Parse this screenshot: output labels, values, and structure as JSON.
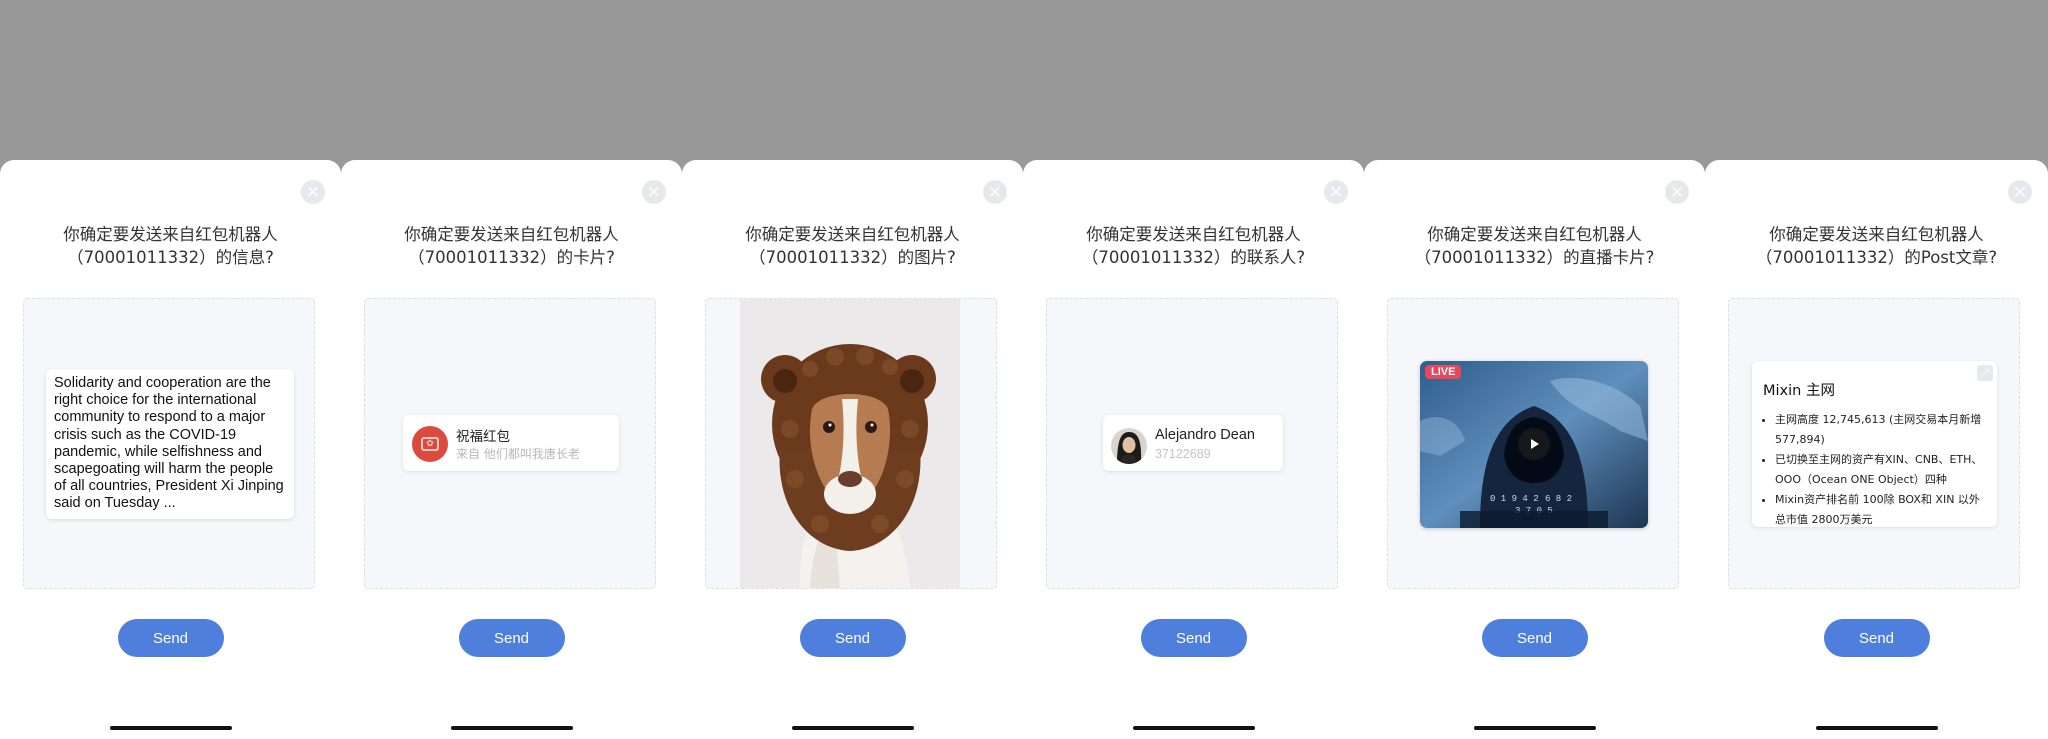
{
  "colors": {
    "send_button": "#4f7fdc",
    "backdrop": "#999999",
    "live_badge": "#e8495a",
    "red_packet": "#dc4a3e"
  },
  "common": {
    "send_label": "Send",
    "close_icon": "close-icon"
  },
  "panels": [
    {
      "title_line1": "你确定要发送来自红包机器人",
      "title_line2": "（70001011332）的信息?",
      "message_text": "Solidarity and cooperation are the right choice for the international community to respond to a major crisis such as the COVID-19 pandemic, while selfishness and scapegoating will harm the people of all countries, President Xi Jinping said on Tuesday ..."
    },
    {
      "title_line1": "你确定要发送来自红包机器人",
      "title_line2": "（70001011332）的卡片?",
      "card_title": "祝福红包",
      "card_subtitle": "来自 他们都叫我唐长老"
    },
    {
      "title_line1": "你确定要发送来自红包机器人",
      "title_line2": "（70001011332）的图片?"
    },
    {
      "title_line1": "你确定要发送来自红包机器人",
      "title_line2": "（70001011332）的联系人?",
      "contact_name": "Alejandro Dean",
      "contact_id": "37122689"
    },
    {
      "title_line1": "你确定要发送来自红包机器人",
      "title_line2": "（70001011332）的直播卡片?",
      "live_badge": "LIVE"
    },
    {
      "title_line1": "你确定要发送来自红包机器人",
      "title_line2": "（70001011332）的Post文章?",
      "post_title": "Mixin 主网",
      "post_items": [
        "主网高度 12,745,613 (主网交易本月新增577,894)",
        "已切换至主网的资产有XIN、CNB、ETH、OOO（Ocean ONE Object）四种",
        "Mixin资产排名前 100除 BOX和 XIN 以外总市值 2800万美元"
      ]
    }
  ]
}
